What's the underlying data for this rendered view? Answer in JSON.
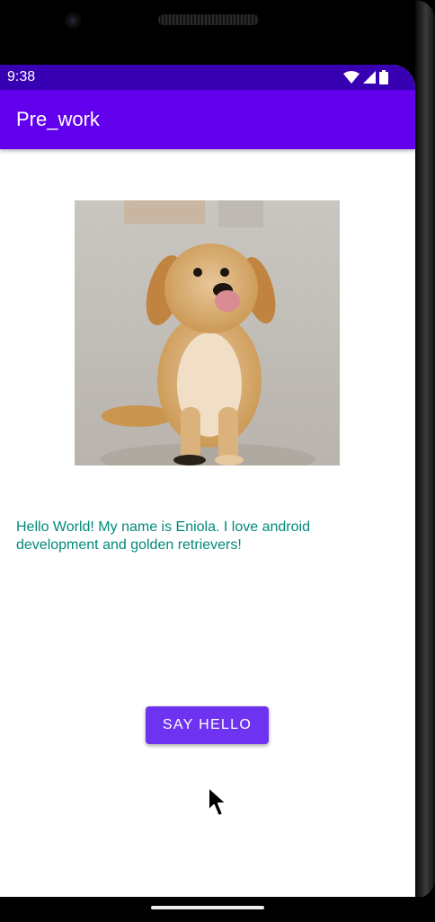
{
  "status_bar": {
    "time": "9:38"
  },
  "app_bar": {
    "title": "Pre_work"
  },
  "main": {
    "photo_icon": "golden-retriever-puppy-photo",
    "hello_text": "Hello World! My name is Eniola. I love android development and golden retrievers!",
    "button_label": "SAY HELLO"
  },
  "colors": {
    "status_bar": "#3700b3",
    "app_bar": "#6200ee",
    "button": "#6e33f0",
    "text_accent": "#00897b"
  }
}
